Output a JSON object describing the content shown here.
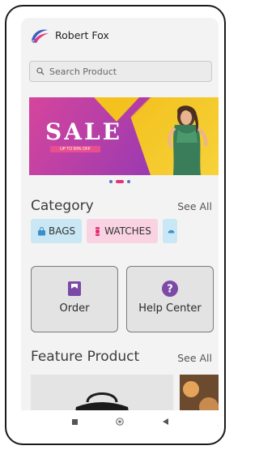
{
  "header": {
    "user_name": "Robert Fox"
  },
  "search": {
    "placeholder": "Search Product"
  },
  "banner": {
    "headline": "SALE",
    "subline": "UP TO 50% OFF"
  },
  "carousel": {
    "count": 3,
    "active": 1
  },
  "category": {
    "title": "Category",
    "see_all": "See All",
    "chips": [
      {
        "label": "BAGS",
        "icon": "bag-icon",
        "color": "#c9e7f4"
      },
      {
        "label": "WATCHES",
        "icon": "watch-icon",
        "color": "#f9d3e2"
      }
    ]
  },
  "actions": [
    {
      "label": "Order",
      "icon": "order-icon",
      "color": "#7a4aa6"
    },
    {
      "label": "Help Center",
      "icon": "help-icon",
      "color": "#7a4aa6"
    }
  ],
  "feature": {
    "title": "Feature Product",
    "see_all": "See All"
  },
  "navbar": {
    "items": [
      "square-icon",
      "home-circle-icon",
      "back-triangle-icon"
    ]
  }
}
